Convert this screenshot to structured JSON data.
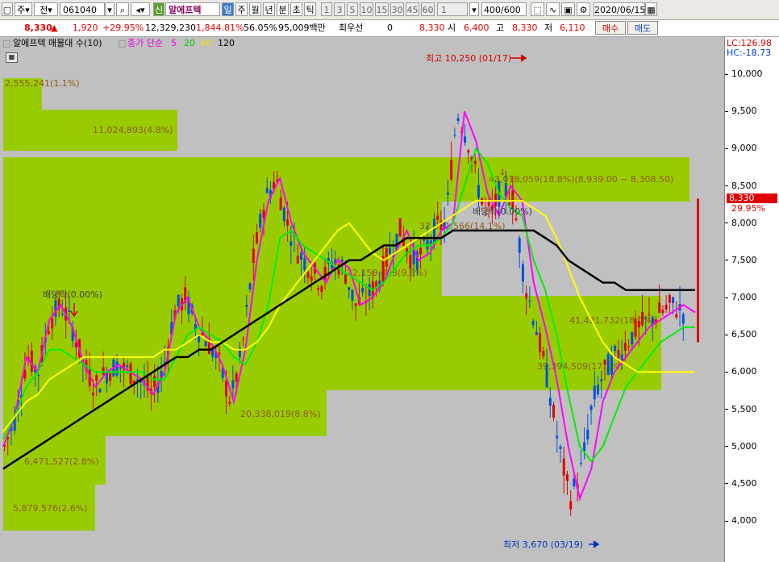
{
  "toolbar": {
    "mode_main": "주",
    "mode_prev": "전",
    "code": "061040",
    "stock_name": "알에프텍",
    "badge": "신",
    "periods": [
      "일",
      "주",
      "월",
      "년",
      "분",
      "초",
      "틱"
    ],
    "numbers": [
      "1",
      "3",
      "5",
      "10",
      "15",
      "30",
      "45",
      "60"
    ],
    "count_value": "1",
    "range_value": "400",
    "range_total": "/600",
    "date": "2020/06/15"
  },
  "quote": {
    "price": "8,330",
    "change": "1,920",
    "change_pct": "+29.95%",
    "volume": "12,329,230",
    "vol_ratio": "1,844.81%",
    "turnover": "56.05%",
    "amount": "95,009백만",
    "best_label": "최우선",
    "best_qty": "0",
    "best_price": "8,330",
    "open_label": "시",
    "open": "6,400",
    "high_label": "고",
    "high": "8,330",
    "low_label": "저",
    "low": "6,110",
    "buy_label": "매수",
    "sell_label": "매도"
  },
  "legend": {
    "title": "알에프텍 매물대 수(10)",
    "ma_label": "종가 단순",
    "ma5": "5",
    "ma20": "20",
    "ma60": "60",
    "ma120": "120"
  },
  "scale": {
    "lc": "LC:126.98",
    "hc": "HC:-18.73",
    "price_tag": "8,330",
    "pct_tag": "29.95%",
    "ticks": [
      "10,000",
      "9,500",
      "9,000",
      "8,500",
      "8,000",
      "7,500",
      "7,000",
      "6,500",
      "6,000",
      "5,500",
      "5,000",
      "4,500",
      "4,000"
    ]
  },
  "annotations": {
    "high": "최고 10,250 (01/17)",
    "low": "최저 3,670 (03/19)",
    "div1": "배당락(0.00%)",
    "div2": "배당락(0.00%)"
  },
  "profile": [
    {
      "label": "2,555,241(1.1%)"
    },
    {
      "label": "11,024,893(4.8%)"
    },
    {
      "label": "43,018,059(18.8%)(8,939.00 ~ 8,308.50)"
    },
    {
      "label": "32,381,566(14.1%)"
    },
    {
      "label": "22,159,463(9.6%)"
    },
    {
      "label": "41,421,732(18.0%)"
    },
    {
      "label": "39,394,509(17.1%)"
    },
    {
      "label": "20,338,019(8.8%)"
    },
    {
      "label": "6,471,527(2.8%)"
    },
    {
      "label": "5,879,576(2.6%)"
    }
  ],
  "chart_data": {
    "type": "line",
    "y_range": [
      3670,
      10250
    ],
    "y_ticks": [
      10000,
      9500,
      9000,
      8500,
      8000,
      7500,
      7000,
      6500,
      6000,
      5500,
      5000,
      4500,
      4000
    ],
    "series": [
      {
        "name": "5",
        "values": [
          5000,
          5400,
          6200,
          6000,
          6700,
          6900,
          6600,
          6100,
          5800,
          6000,
          6100,
          6000,
          5900,
          5700,
          6000,
          6800,
          7000,
          6600,
          6400,
          6100,
          5600,
          6300,
          7500,
          8300,
          8600,
          8000,
          7600,
          7400,
          7200,
          7500,
          7400,
          6900,
          7000,
          7200,
          7600,
          7900,
          7500,
          7600,
          7900,
          8000,
          9500,
          9100,
          8400,
          8100,
          8500,
          8300,
          7200,
          6600,
          5900,
          5000,
          4300,
          4700,
          5600,
          6000,
          6200,
          6400,
          6600,
          6700,
          6800,
          6900,
          6800
        ]
      },
      {
        "name": "20",
        "values": [
          5100,
          5400,
          5800,
          6000,
          6300,
          6300,
          6200,
          6100,
          6000,
          6000,
          6000,
          6000,
          6000,
          5900,
          5900,
          6200,
          6500,
          6600,
          6500,
          6400,
          6200,
          6100,
          6400,
          6900,
          7800,
          7900,
          7700,
          7600,
          7500,
          7400,
          7300,
          7200,
          7100,
          7200,
          7400,
          7600,
          7700,
          7700,
          7800,
          8000,
          8500,
          9000,
          8800,
          8400,
          8200,
          8100,
          7500,
          7100,
          6500,
          5700,
          5000,
          4800,
          5000,
          5400,
          5800,
          6000,
          6200,
          6400,
          6500,
          6600,
          6600
        ]
      },
      {
        "name": "60",
        "values": [
          5200,
          5400,
          5600,
          5700,
          5900,
          6000,
          6100,
          6200,
          6200,
          6200,
          6200,
          6200,
          6200,
          6200,
          6300,
          6300,
          6400,
          6500,
          6400,
          6400,
          6300,
          6300,
          6400,
          6600,
          6900,
          7100,
          7300,
          7500,
          7700,
          7900,
          8000,
          7800,
          7600,
          7500,
          7600,
          7700,
          7800,
          7900,
          8000,
          8100,
          8200,
          8300,
          8300,
          8300,
          8300,
          8300,
          8200,
          8100,
          7800,
          7400,
          7000,
          6700,
          6400,
          6200,
          6100,
          6000,
          6000,
          6000,
          6000,
          6000,
          6000
        ]
      },
      {
        "name": "120",
        "values": [
          4700,
          4800,
          4900,
          5000,
          5100,
          5200,
          5300,
          5400,
          5500,
          5600,
          5700,
          5800,
          5900,
          6000,
          6100,
          6200,
          6200,
          6300,
          6300,
          6400,
          6500,
          6600,
          6700,
          6800,
          6900,
          7000,
          7100,
          7200,
          7300,
          7400,
          7500,
          7500,
          7600,
          7700,
          7700,
          7800,
          7800,
          7800,
          7800,
          7900,
          7900,
          7900,
          7900,
          7900,
          7900,
          7900,
          7900,
          7800,
          7700,
          7500,
          7400,
          7300,
          7200,
          7200,
          7100,
          7100,
          7100,
          7100,
          7100,
          7100,
          7100
        ]
      }
    ]
  },
  "colors": {
    "profile": "#99cc00",
    "up": "#e00000",
    "down": "#0050e0",
    "ma5": "#ff00ff",
    "ma20": "#00ee00",
    "ma60": "#ffff00",
    "ma120": "#000000",
    "label": "#8b5a14"
  }
}
